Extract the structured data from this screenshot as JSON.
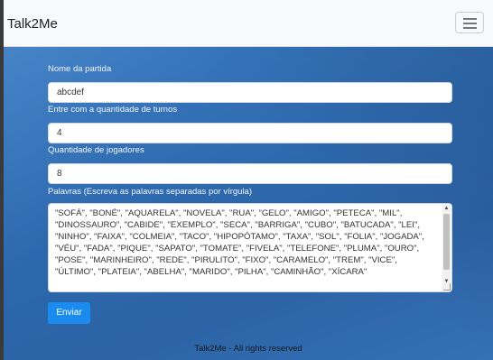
{
  "navbar": {
    "brand": "Talk2Me",
    "toggler_icon": "hamburger-menu-icon"
  },
  "form": {
    "match_name": {
      "label": "Nome da partida",
      "value": "abcdef"
    },
    "turns": {
      "label": "Entre com a quantidade de turnos",
      "value": "4"
    },
    "players": {
      "label": "Quantidade de jogadores",
      "value": "8"
    },
    "words": {
      "label": "Palavras (Escreva as palavras separadas por vírgula)",
      "value": " \"SOFÁ\", \"BONÉ\", \"AQUARELA\", \"NOVELA\", \"RUA\", \"GELO\", \"AMIGO\", \"PETECA\", \"MIL\", \"DINOSSAURO\", \"CABIDE\", \"EXEMPLO\", \"SECA\", \"BARRIGA\", \"CUBO\", \"BATUCADA\", \"LEI\", \"NINHO\", \"FAIXA\", \"COLMEIA\", \"TACO\", \"HIPOPÓTAMO\", \"TAXA\", \"SOL\", \"FOLIA\", \"JOGADA\", \"VÉU\", \"FADA\", \"PIQUE\", \"SAPATO\", \"TOMATE\", \"FIVELA\", \"TELEFONE\", \"PLUMA\", \"OURO\", \"POSE\", \"MARINHEIRO\", \"REDE\", \"PIRULITO\", \"FIXO\", \"CARAMELO\", \"TREM\", \"VICE\", \"ÚLTIMO\", \"PLATEIA\", \"ABELHA\", \"MARIDO\", \"PILHA\", \"CAMINHÃO\", \"XÍCARA\""
    },
    "submit_label": "Enviar"
  },
  "footer": {
    "text": "Talk2Me - All rights reserved"
  },
  "colors": {
    "background": "#2f6fb6",
    "button": "#1a8cf0",
    "navbar": "#f8f9fa"
  }
}
